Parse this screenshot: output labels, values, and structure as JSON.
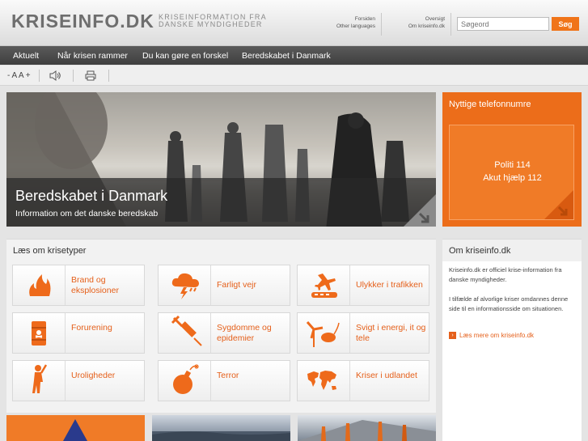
{
  "header": {
    "logo": "KRISEINFO.DK",
    "tagline_line1": "KRISEINFORMATION FRA",
    "tagline_line2": "DANSKE MYNDIGHEDER",
    "links_col1": [
      "Forsiden",
      "Other languages"
    ],
    "links_col2": [
      "Oversigt",
      "Om kriseinfo.dk"
    ],
    "search_placeholder": "Søgeord",
    "search_button": "Søg"
  },
  "nav": [
    "Aktuelt",
    "Når krisen rammer",
    "Du kan gøre en forskel",
    "Beredskabet i Danmark"
  ],
  "toolbar": {
    "text_size": "- A A +",
    "read_aloud_icon": "speaker-icon",
    "print_icon": "printer-icon"
  },
  "hero": {
    "title": "Beredskabet i Danmark",
    "subtitle": "Information om det danske beredskab"
  },
  "phone": {
    "title": "Nyttige telefonnumre",
    "lines": [
      "Politi 114",
      "Akut hjælp 112"
    ]
  },
  "crisis": {
    "title": "Læs om krisetyper",
    "tiles": [
      {
        "label_lines": [
          "Brand og",
          "eksplosioner"
        ],
        "icon": "fire-icon"
      },
      {
        "label_lines": [
          "Farligt vejr"
        ],
        "icon": "storm-icon"
      },
      {
        "label_lines": [
          "Ulykker i trafikken"
        ],
        "icon": "traffic-icon"
      },
      {
        "label_lines": [
          "Forurening"
        ],
        "icon": "toxic-barrel-icon"
      },
      {
        "label_lines": [
          "Sygdomme og",
          "epidemier"
        ],
        "icon": "syringe-icon"
      },
      {
        "label_lines": [
          "Svigt i energi, it og",
          "tele"
        ],
        "icon": "energy-icon"
      },
      {
        "label_lines": [
          "Uroligheder"
        ],
        "icon": "protest-icon"
      },
      {
        "label_lines": [
          "Terror"
        ],
        "icon": "bomb-icon"
      },
      {
        "label_lines": [
          "Kriser i udlandet"
        ],
        "icon": "world-map-icon"
      }
    ]
  },
  "about": {
    "title": "Om kriseinfo.dk",
    "para1": "Kriseinfo.dk er officiel krise-information fra danske myndigheder.",
    "para2": "I tilfælde af alvorlige kriser omdannes denne side til en informationsside om situationen.",
    "link": "Læs mere om kriseinfo.dk"
  },
  "colors": {
    "accent": "#ec6d1a",
    "nav_bg": "#4a4a4a",
    "tile_label": "#e5601b"
  }
}
